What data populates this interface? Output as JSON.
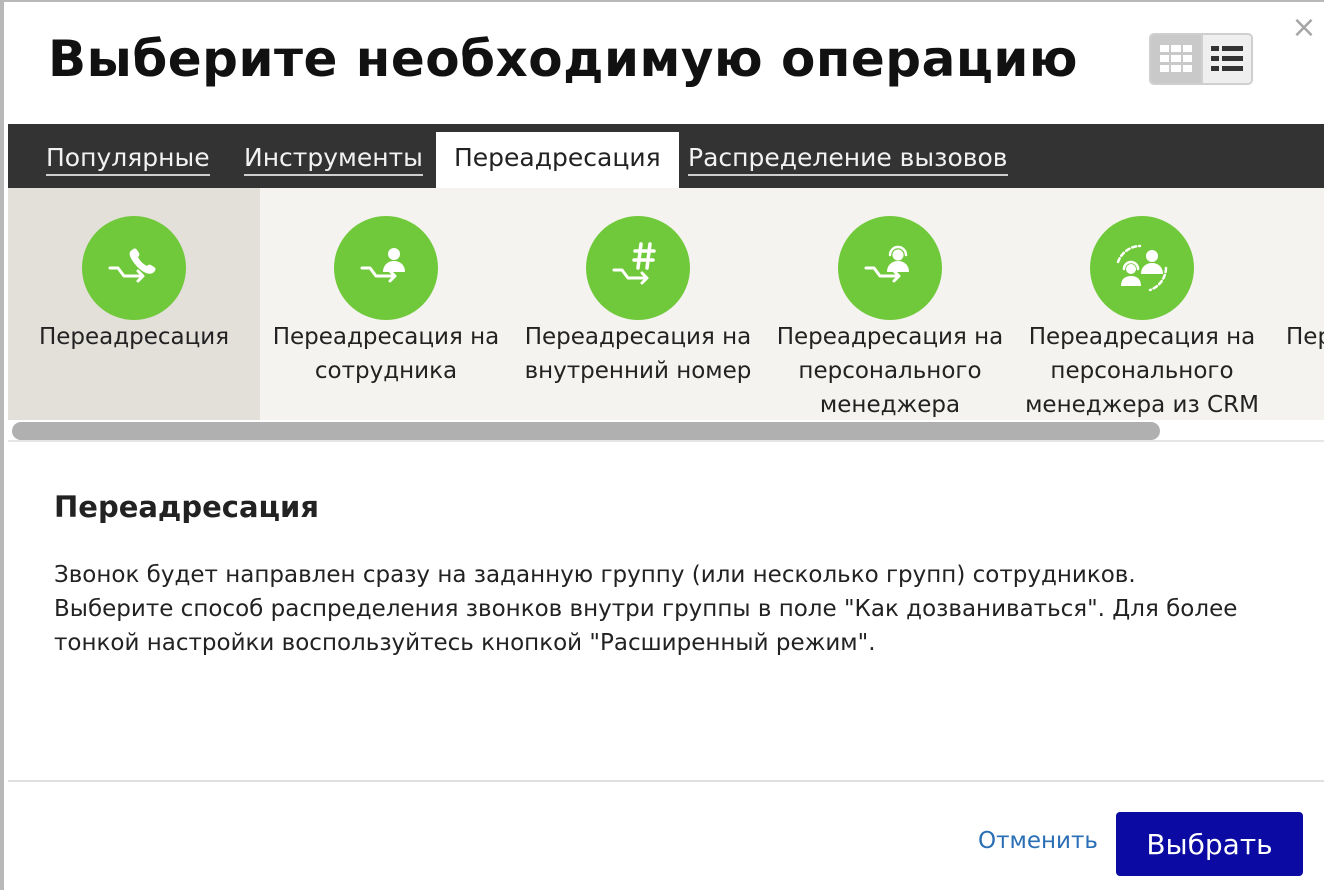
{
  "dialog": {
    "title": "Выберите необходимую операцию",
    "close_label": "×"
  },
  "view_toggle": {
    "grid_icon": "grid-view-icon",
    "list_icon": "list-view-icon",
    "selected": "grid"
  },
  "tabs": [
    {
      "label": "Популярные"
    },
    {
      "label": "Инструменты"
    },
    {
      "label": "Переадресация",
      "active": true
    },
    {
      "label": "Распределение вызовов"
    }
  ],
  "operations": [
    {
      "label_line1": "Переадресация",
      "label_line2": "",
      "label_line3": "",
      "icon": "call-forward-icon",
      "selected": true
    },
    {
      "label_line1": "Переадресация на",
      "label_line2": "сотрудника",
      "label_line3": "",
      "icon": "forward-to-employee-icon"
    },
    {
      "label_line1": "Переадресация на",
      "label_line2": "внутренний номер",
      "label_line3": "",
      "icon": "forward-to-extension-icon"
    },
    {
      "label_line1": "Переадресация на",
      "label_line2": "персонального",
      "label_line3": "менеджера",
      "icon": "forward-to-personal-manager-icon"
    },
    {
      "label_line1": "Переадресация на",
      "label_line2": "персонального",
      "label_line3": "менеджера из CRM",
      "icon": "forward-to-crm-manager-icon"
    },
    {
      "label_line1": "Пер",
      "label_line2": "",
      "label_line3": "",
      "icon": ""
    }
  ],
  "description": {
    "title": "Переадресация",
    "line1": "Звонок будет направлен сразу на заданную группу (или несколько групп) сотрудников.",
    "line2": "Выберите способ распределения звонков внутри группы в поле \"Как дозваниваться\". Для более",
    "line3": "тонкой настройки воспользуйтесь кнопкой \"Расширенный режим\"."
  },
  "footer": {
    "cancel_label": "Отменить",
    "select_label": "Выбрать"
  },
  "colors": {
    "accent_green": "#70c93b",
    "tabbar_bg": "#333333",
    "primary_button": "#0b0aa3",
    "link": "#2a6fb5"
  }
}
